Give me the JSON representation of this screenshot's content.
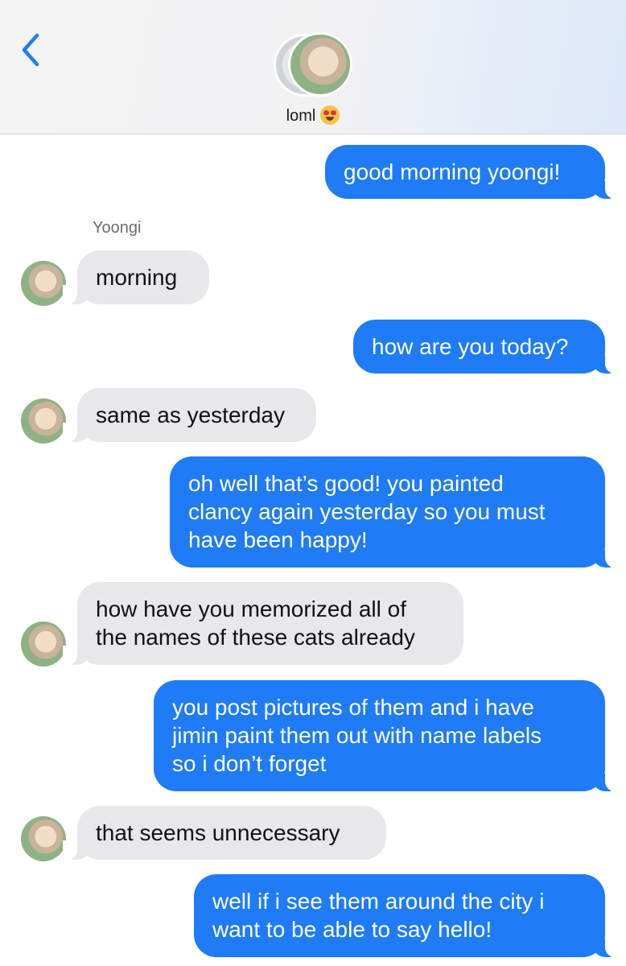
{
  "header": {
    "contact_name": "loml",
    "icons": {
      "back": "chevron-left-icon",
      "emoji": "heart-eyes-emoji-icon"
    }
  },
  "conversation": {
    "sender_label": "Yoongi",
    "messages": [
      {
        "from": "me",
        "text": "good morning yoongi!"
      },
      {
        "from": "them",
        "text": "morning"
      },
      {
        "from": "me",
        "text": "how are you today?"
      },
      {
        "from": "them",
        "text": "same as yesterday"
      },
      {
        "from": "me",
        "text": "oh well that’s good! you painted\nclancy again yesterday so you must\nhave been happy!"
      },
      {
        "from": "them",
        "text": "how have you memorized all of\nthe names of these cats already"
      },
      {
        "from": "me",
        "text": "you post pictures of them and i have\njimin paint them out with name labels\nso i don’t forget"
      },
      {
        "from": "them",
        "text": "that seems unnecessary"
      },
      {
        "from": "me",
        "text": "well if i see them around the city i\nwant to be able to say hello!"
      }
    ]
  },
  "colors": {
    "sent_bubble": "#1f7bf6",
    "received_bubble": "#e8e8ec",
    "accent": "#1f7bf6"
  }
}
